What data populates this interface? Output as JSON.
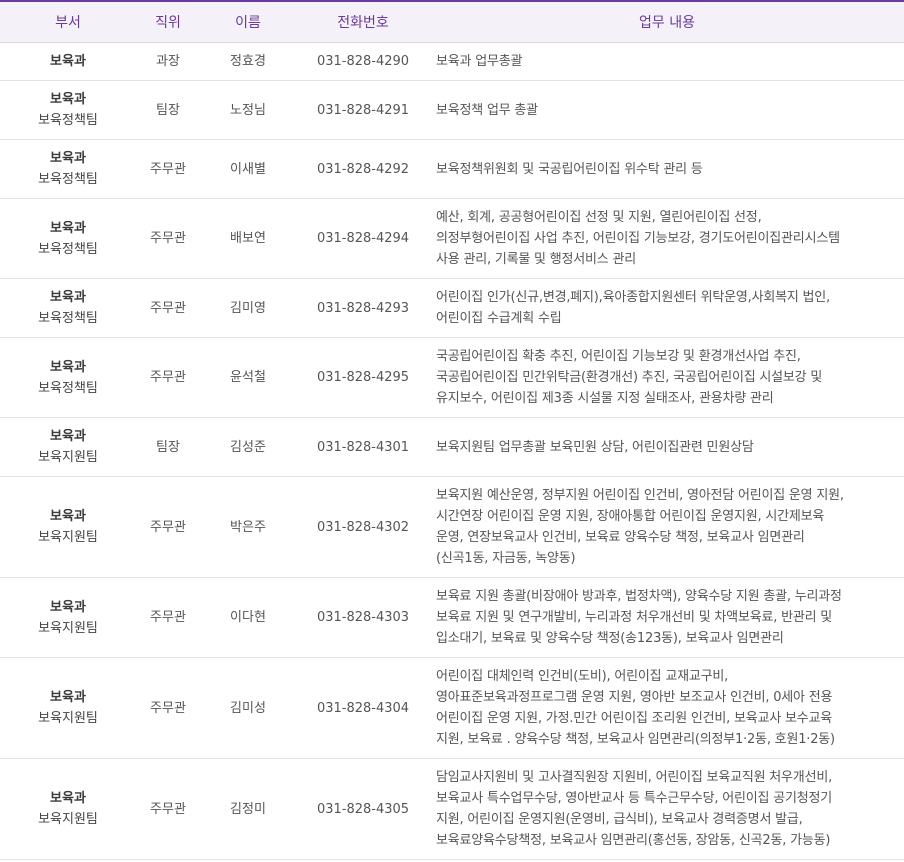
{
  "headers": {
    "department": "부서",
    "position": "직위",
    "name": "이름",
    "phone": "전화번호",
    "duties": "업무 내용"
  },
  "rows": [
    {
      "dept": "보육과",
      "team": "",
      "position": "과장",
      "name": "정효경",
      "phone": "031-828-4290",
      "duties": "보육과 업무총괄"
    },
    {
      "dept": "보육과",
      "team": "보육정책팀",
      "position": "팀장",
      "name": "노정님",
      "phone": "031-828-4291",
      "duties": "보육정책 업무 총괄"
    },
    {
      "dept": "보육과",
      "team": "보육정책팀",
      "position": "주무관",
      "name": "이새별",
      "phone": "031-828-4292",
      "duties": "보육정책위원회 및 국공립어린이집 위수탁 관리 등"
    },
    {
      "dept": "보육과",
      "team": "보육정책팀",
      "position": "주무관",
      "name": "배보연",
      "phone": "031-828-4294",
      "duties": "예산, 회계, 공공형어린이집 선정 및 지원, 열린어린이집 선정,\n의정부형어린이집 사업 추진, 어린이집 기능보강, 경기도어린이집관리시스템\n사용 관리, 기록물 및 행정서비스 관리"
    },
    {
      "dept": "보육과",
      "team": "보육정책팀",
      "position": "주무관",
      "name": "김미영",
      "phone": "031-828-4293",
      "duties": "어린이집 인가(신규,변경,폐지),육아종합지원센터 위탁운영,사회복지 법인,\n어린이집 수급계획 수립"
    },
    {
      "dept": "보육과",
      "team": "보육정책팀",
      "position": "주무관",
      "name": "윤석철",
      "phone": "031-828-4295",
      "duties": "국공립어린이집 확충 추진, 어린이집 기능보강 및 환경개선사업 추진,\n국공립어린이집 민간위탁금(환경개선) 추진, 국공립어린이집 시설보강 및\n유지보수, 어린이집 제3종 시설물 지정 실태조사, 관용차량 관리"
    },
    {
      "dept": "보육과",
      "team": "보육지원팀",
      "position": "팀장",
      "name": "김성준",
      "phone": "031-828-4301",
      "duties": "보육지원팀 업무총괄 보육민원 상담, 어린이집관련 민원상담"
    },
    {
      "dept": "보육과",
      "team": "보육지원팀",
      "position": "주무관",
      "name": "박은주",
      "phone": "031-828-4302",
      "duties": "보육지원 예산운영, 정부지원 어린이집 인건비, 영아전담 어린이집 운영 지원,\n시간연장 어린이집 운영 지원, 장애아통합 어린이집 운영지원, 시간제보육\n운영, 연장보육교사 인건비, 보육료 양육수당 책정, 보육교사 임면관리\n(신곡1동, 자금동, 녹양동)"
    },
    {
      "dept": "보육과",
      "team": "보육지원팀",
      "position": "주무관",
      "name": "이다현",
      "phone": "031-828-4303",
      "duties": "보육료 지원 총괄(비장애아 방과후, 법정차액), 양육수당 지원 총괄, 누리과정\n보육료 지원 및 연구개발비, 누리과정 처우개선비 및 차액보육료, 반관리 및\n입소대기, 보육료 및 양육수당 책정(송123동), 보육교사 임면관리"
    },
    {
      "dept": "보육과",
      "team": "보육지원팀",
      "position": "주무관",
      "name": "김미성",
      "phone": "031-828-4304",
      "duties": "어린이집 대체인력 인건비(도비), 어린이집 교재교구비,\n영아표준보육과정프로그램 운영 지원, 영아반 보조교사 인건비, 0세아 전용\n어린이집 운영 지원, 가정.민간 어린이집 조리원 인건비, 보육교사 보수교육\n지원, 보육료 . 양육수당 책정, 보육교사 임면관리(의정부1·2동, 호원1·2동)"
    },
    {
      "dept": "보육과",
      "team": "보육지원팀",
      "position": "주무관",
      "name": "김정미",
      "phone": "031-828-4305",
      "duties": "담임교사지원비 및 고사결직원장 지원비, 어린이집 보육교직원 처우개선비,\n보육교사 특수업무수당, 영아반교사 등 특수근무수당, 어린이집 공기청정기\n지원, 어린이집 운영지원(운영비, 급식비), 보육교사 경력증명서 발급,\n보육료양육수당책정, 보육교사 임면관리(홍선동, 장암동, 신곡2동, 가능동)"
    }
  ],
  "colors": {
    "header_text": "#6a3a9c",
    "header_bg": "#f5f1f8",
    "top_border": "#6b3aa0"
  }
}
